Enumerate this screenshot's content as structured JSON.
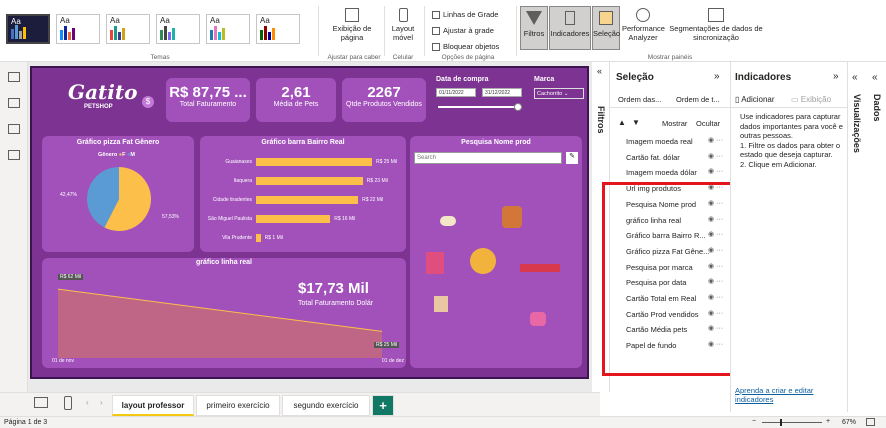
{
  "ribbon": {
    "themes_label": "Temas",
    "page_view": "Exibição de página",
    "ajustar_label": "Ajustar para caber",
    "layout_movel": "Layout móvel",
    "celular": "Celular",
    "linhas_grade": "Linhas de Grade",
    "ajustar_grade": "Ajustar à grade",
    "bloquear": "Bloquear objetos",
    "opcoes_pagina": "Opções de página",
    "filtros": "Filtros",
    "indicadores": "Indicadores",
    "selecao": "Seleção",
    "performance": "Performance Analyzer",
    "segmentacoes": "Segmentações de dados de sincronização",
    "mostrar_paineis": "Mostrar painéis",
    "theme_aa": "Aa"
  },
  "report": {
    "logo": "Gatito",
    "logo_sub": "PETSHOP",
    "kpis": [
      {
        "value": "R$ 87,75 ...",
        "label": "Total Faturamento"
      },
      {
        "value": "2,61",
        "label": "Média de Pets"
      },
      {
        "value": "2267",
        "label": "Qtde Produtos Vendidos"
      }
    ],
    "data_compra": {
      "label": "Data de compra",
      "from": "01/11/2022",
      "to": "31/12/2022"
    },
    "marca": {
      "label": "Marca",
      "value": "Cachorrito"
    },
    "pie_title": "Gráfico pizza Fat Gênero",
    "pie_legend": "Gênero",
    "pie_f": "F",
    "pie_m": "M",
    "pie_left": "42,47%",
    "pie_right": "57,53%",
    "bar_title": "Gráfico barra Bairro Real",
    "line_title": "gráfico linha real",
    "line_start": "R$ 62 Mil",
    "line_end": "R$ 25 Mil",
    "line_x0": "01 de nov",
    "line_x1": "01 de dez",
    "big_value": "$17,73 Mil",
    "big_label": "Total Faturamento Dolár",
    "search_title": "Pesquisa Nome prod",
    "search_placeholder": "Search"
  },
  "chart_data": [
    {
      "type": "pie",
      "title": "Gráfico pizza Fat Gênero",
      "legend_title": "Gênero",
      "series": [
        {
          "name": "F",
          "value": 57.53,
          "color": "#fcbf49"
        },
        {
          "name": "M",
          "value": 42.47,
          "color": "#5b9bd5"
        }
      ]
    },
    {
      "type": "bar",
      "title": "Gráfico barra Bairro Real",
      "categories": [
        "Guaianases",
        "Itaquera",
        "Cidade tiradentes",
        "São Miguel Paulista",
        "Vila Prudente"
      ],
      "values": [
        25,
        23,
        22,
        16,
        1
      ],
      "labels": [
        "R$ 25 Mil",
        "R$ 23 Mil",
        "R$ 22 Mil",
        "R$ 16 Mil",
        "R$ 1 Mil"
      ]
    },
    {
      "type": "area",
      "title": "gráfico linha real",
      "x": [
        "01 de nov",
        "01 de dez"
      ],
      "values": [
        62,
        25
      ],
      "labels": [
        "R$ 62 Mil",
        "R$ 25 Mil"
      ]
    }
  ],
  "selection": {
    "title": "Seleção",
    "order1": "Ordem das...",
    "order2": "Ordem de t...",
    "show": "Mostrar",
    "hide": "Ocultar",
    "filters": "Filtros",
    "items": [
      "Imagem moeda real",
      "Cartão fat. dólar",
      "Imagem moeda dólar",
      "Url img produtos",
      "Pesquisa Nome prod",
      "gráfico linha real",
      "Gráfico barra Bairro R...",
      "Gráfico pizza Fat Gêne...",
      "Pesquisa por marca",
      "Pesquisa por data",
      "Cartão Total em Real",
      "Cartão Prod vendidos",
      "Cartão Média pets",
      "Papel de fundo"
    ]
  },
  "indicators": {
    "title": "Indicadores",
    "add": "Adicionar",
    "view": "Exibição",
    "help": "Use indicadores para capturar dados importantes para você e outras pessoas.\n1. Filtre os dados para obter o estado que deseja capturar.\n2. Clique em Adicionar.",
    "link": "Aprenda a criar e editar indicadores"
  },
  "viz": {
    "dados": "Dados",
    "visualizacoes": "Visualizações"
  },
  "tabs": [
    "layout professor",
    "primeiro exercício",
    "segundo exercício"
  ],
  "status": {
    "page": "Página 1 de 3",
    "zoom": "67%"
  }
}
